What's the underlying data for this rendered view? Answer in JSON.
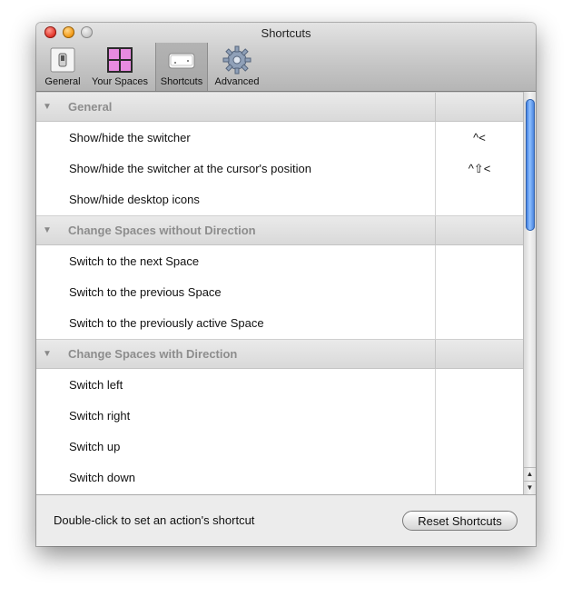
{
  "window": {
    "title": "Shortcuts"
  },
  "toolbar": {
    "items": [
      {
        "label": "General",
        "icon": "switch-icon"
      },
      {
        "label": "Your Spaces",
        "icon": "spaces-grid-icon"
      },
      {
        "label": "Shortcuts",
        "icon": "keyboard-key-icon",
        "selected": true
      },
      {
        "label": "Advanced",
        "icon": "gear-icon"
      }
    ]
  },
  "groups": [
    {
      "title": "General",
      "items": [
        {
          "label": "Show/hide the switcher",
          "shortcut": "^<"
        },
        {
          "label": "Show/hide the switcher at the cursor's position",
          "shortcut": "^⇧<"
        },
        {
          "label": "Show/hide desktop icons",
          "shortcut": ""
        }
      ]
    },
    {
      "title": "Change Spaces without Direction",
      "items": [
        {
          "label": "Switch to the next Space",
          "shortcut": ""
        },
        {
          "label": "Switch to the previous Space",
          "shortcut": ""
        },
        {
          "label": "Switch to the previously active Space",
          "shortcut": ""
        }
      ]
    },
    {
      "title": "Change Spaces with Direction",
      "items": [
        {
          "label": "Switch left",
          "shortcut": ""
        },
        {
          "label": "Switch right",
          "shortcut": ""
        },
        {
          "label": "Switch up",
          "shortcut": ""
        },
        {
          "label": "Switch down",
          "shortcut": ""
        }
      ]
    }
  ],
  "footer": {
    "hint": "Double-click to set an action's shortcut",
    "reset_label": "Reset Shortcuts"
  }
}
